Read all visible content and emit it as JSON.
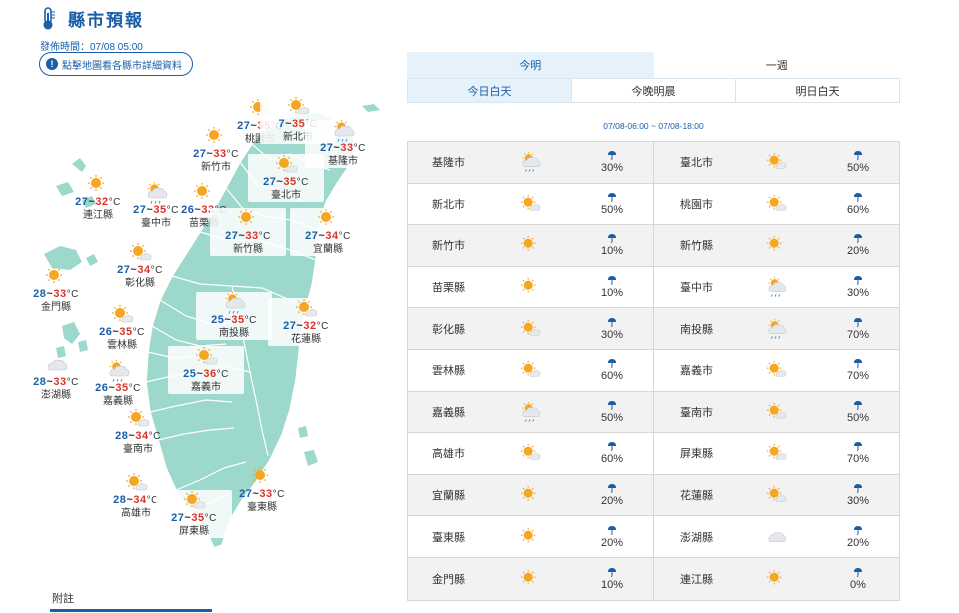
{
  "header": {
    "title": "縣市預報",
    "icon": "thermometer-icon"
  },
  "publish_time": "發佈時間：07/08 05:00",
  "map_hint": {
    "label": "點擊地圖看各縣市詳細資料",
    "icon": "info-icon"
  },
  "tabs": {
    "top": [
      {
        "label": "今明",
        "active": true
      },
      {
        "label": "一週",
        "active": false
      }
    ],
    "sub": [
      {
        "label": "今日白天",
        "active": true
      },
      {
        "label": "今晚明晨",
        "active": false
      },
      {
        "label": "明日白天",
        "active": false
      }
    ]
  },
  "period": "07/08-06:00 ~ 07/08-18:00",
  "map_cities": [
    {
      "name": "桃園市",
      "lo": "27",
      "hi": "35",
      "icon": "sunny-cloudy"
    },
    {
      "name": "新北市",
      "lo": "7",
      "hi": "35",
      "icon": "sunny-cloudy"
    },
    {
      "name": "新竹市",
      "lo": "27",
      "hi": "33",
      "icon": "sunny"
    },
    {
      "name": "基隆市",
      "lo": "27",
      "hi": "33",
      "icon": "cloudy-rain"
    },
    {
      "name": "臺北市",
      "lo": "27",
      "hi": "35",
      "icon": "sunny-cloudy"
    },
    {
      "name": "連江縣",
      "lo": "27",
      "hi": "32",
      "icon": "sunny"
    },
    {
      "name": "臺中市",
      "lo": "27",
      "hi": "35",
      "icon": "cloudy-rain"
    },
    {
      "name": "苗栗縣",
      "lo": "26",
      "hi": "33",
      "icon": "sunny"
    },
    {
      "name": "新竹縣",
      "lo": "27",
      "hi": "33",
      "icon": "sunny"
    },
    {
      "name": "宜蘭縣",
      "lo": "27",
      "hi": "34",
      "icon": "sunny"
    },
    {
      "name": "彰化縣",
      "lo": "27",
      "hi": "34",
      "icon": "sunny-cloudy"
    },
    {
      "name": "金門縣",
      "lo": "28",
      "hi": "33",
      "icon": "sunny"
    },
    {
      "name": "南投縣",
      "lo": "25",
      "hi": "35",
      "icon": "cloudy-rain"
    },
    {
      "name": "花蓮縣",
      "lo": "27",
      "hi": "32",
      "icon": "sunny-cloudy"
    },
    {
      "name": "雲林縣",
      "lo": "26",
      "hi": "35",
      "icon": "sunny-cloudy"
    },
    {
      "name": "澎湖縣",
      "lo": "28",
      "hi": "33",
      "icon": "cloudy"
    },
    {
      "name": "嘉義市",
      "lo": "25",
      "hi": "36",
      "icon": "sunny-cloudy"
    },
    {
      "name": "嘉義縣",
      "lo": "26",
      "hi": "35",
      "icon": "cloudy-rain"
    },
    {
      "name": "臺南市",
      "lo": "28",
      "hi": "34",
      "icon": "sunny-cloudy"
    },
    {
      "name": "高雄市",
      "lo": "28",
      "hi": "34",
      "icon": "sunny-cloudy"
    },
    {
      "name": "臺東縣",
      "lo": "27",
      "hi": "33",
      "icon": "sunny"
    },
    {
      "name": "屏東縣",
      "lo": "27",
      "hi": "35",
      "icon": "sunny-cloudy"
    }
  ],
  "table_rows": [
    [
      {
        "city": "基隆市",
        "icon": "cloudy-rain",
        "rain": "30%"
      },
      {
        "city": "臺北市",
        "icon": "sunny-cloudy",
        "rain": "50%"
      }
    ],
    [
      {
        "city": "新北市",
        "icon": "sunny-cloudy",
        "rain": "50%"
      },
      {
        "city": "桃園市",
        "icon": "sunny-cloudy",
        "rain": "60%"
      }
    ],
    [
      {
        "city": "新竹市",
        "icon": "sunny",
        "rain": "10%"
      },
      {
        "city": "新竹縣",
        "icon": "sunny",
        "rain": "20%"
      }
    ],
    [
      {
        "city": "苗栗縣",
        "icon": "sunny",
        "rain": "10%"
      },
      {
        "city": "臺中市",
        "icon": "cloudy-rain",
        "rain": "30%"
      }
    ],
    [
      {
        "city": "彰化縣",
        "icon": "sunny-cloudy",
        "rain": "30%"
      },
      {
        "city": "南投縣",
        "icon": "cloudy-rain",
        "rain": "70%"
      }
    ],
    [
      {
        "city": "雲林縣",
        "icon": "sunny-cloudy",
        "rain": "60%"
      },
      {
        "city": "嘉義市",
        "icon": "sunny-cloudy",
        "rain": "70%"
      }
    ],
    [
      {
        "city": "嘉義縣",
        "icon": "cloudy-rain",
        "rain": "50%"
      },
      {
        "city": "臺南市",
        "icon": "sunny-cloudy",
        "rain": "50%"
      }
    ],
    [
      {
        "city": "高雄市",
        "icon": "sunny-cloudy",
        "rain": "60%"
      },
      {
        "city": "屏東縣",
        "icon": "sunny-cloudy",
        "rain": "70%"
      }
    ],
    [
      {
        "city": "宜蘭縣",
        "icon": "sunny",
        "rain": "20%"
      },
      {
        "city": "花蓮縣",
        "icon": "sunny-cloudy",
        "rain": "30%"
      }
    ],
    [
      {
        "city": "臺東縣",
        "icon": "sunny",
        "rain": "20%"
      },
      {
        "city": "澎湖縣",
        "icon": "cloudy",
        "rain": "20%"
      }
    ],
    [
      {
        "city": "金門縣",
        "icon": "sunny",
        "rain": "10%"
      },
      {
        "city": "連江縣",
        "icon": "sunny",
        "rain": "0%"
      }
    ]
  ],
  "footnote": "附註",
  "colors": {
    "accent": "#1a5ea8",
    "land": "#9dd8cd",
    "low_temp": "#1a5ea8",
    "high_temp": "#d8352a",
    "sun": "#f5a623"
  }
}
